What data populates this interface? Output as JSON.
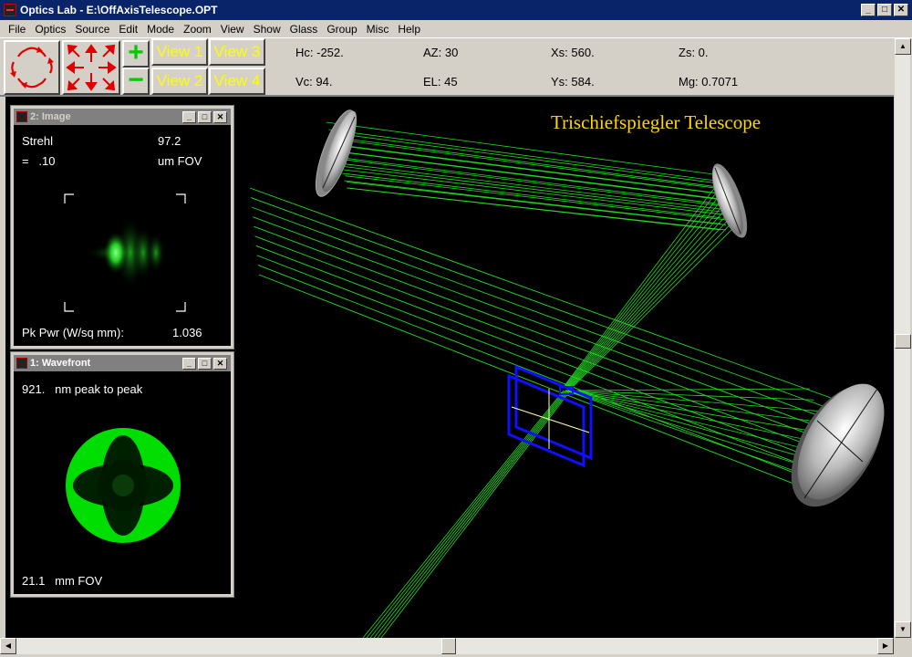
{
  "window": {
    "title": "Optics Lab  -  E:\\OffAxisTelescope.OPT",
    "min_label": "_",
    "max_label": "□",
    "close_label": "✕"
  },
  "menu": [
    "File",
    "Optics",
    "Source",
    "Edit",
    "Mode",
    "Zoom",
    "View",
    "Show",
    "Glass",
    "Group",
    "Misc",
    "Help"
  ],
  "toolbar": {
    "zoom_in_label": "+",
    "zoom_out_label": "−",
    "views": [
      "View 1",
      "View 3",
      "View 2",
      "View 4"
    ],
    "readouts": {
      "hc": "Hc: -252.",
      "vc": "Vc: 94.",
      "az": "AZ: 30",
      "el": "EL: 45",
      "xs": "Xs: 560.",
      "ys": "Ys: 584.",
      "zs": "Zs: 0.",
      "mg": "Mg: 0.7071"
    }
  },
  "scene": {
    "title": "Trischiefspiegler Telescope",
    "ray_color": "#22dd22",
    "detector_color": "#1010ff"
  },
  "image_window": {
    "title": "2: Image",
    "strehl_label": "Strehl",
    "strehl_value": "97.2",
    "fov_prefix": "=   .10",
    "fov_suffix": "um FOV",
    "peak_label": "Pk Pwr (W/sq mm):",
    "peak_value": "1.036"
  },
  "wavefront_window": {
    "title": "1: Wavefront",
    "p2p": "921.   nm peak to peak",
    "fov": "21.1   mm FOV"
  },
  "colors": {
    "view_label": "#ffff00",
    "accent_red": "#e00000",
    "accent_green": "#00cc00"
  }
}
